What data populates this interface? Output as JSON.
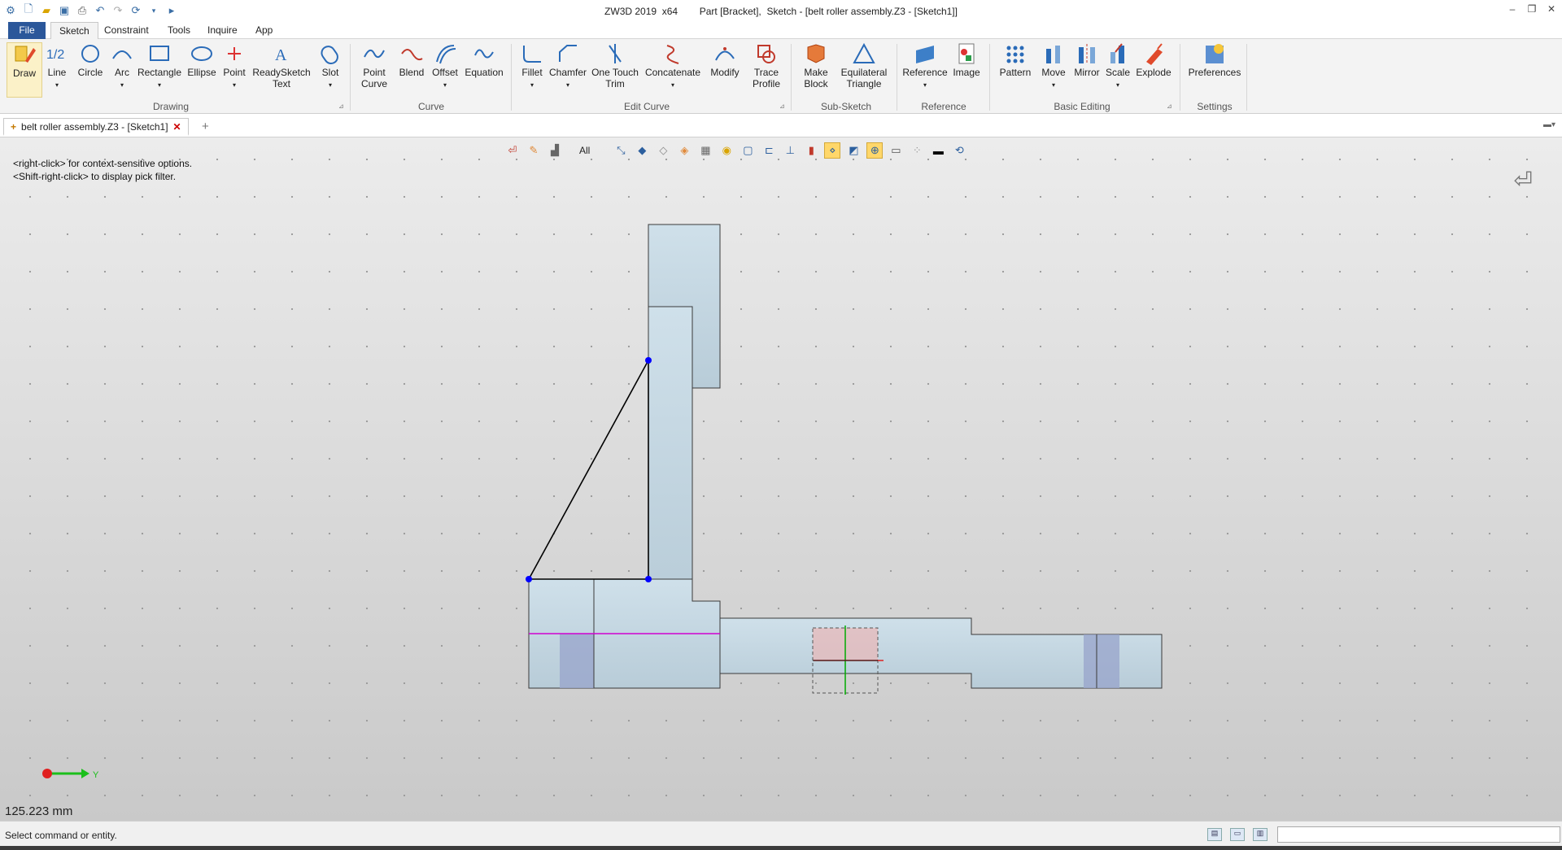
{
  "titlebar": {
    "title": "ZW3D 2019  x64        Part [Bracket],  Sketch - [belt roller assembly.Z3 - [Sketch1]]",
    "quick_access": [
      "app-logo-icon",
      "new-file-icon",
      "open-folder-icon",
      "save-icon",
      "print-icon",
      "undo-icon",
      "redo-icon",
      "rebuild-icon",
      "dropdown-arrow-icon",
      "run-icon"
    ]
  },
  "menu": {
    "tabs": [
      "File",
      "Sketch",
      "Constraint",
      "Tools",
      "Inquire",
      "App"
    ],
    "active": "Sketch"
  },
  "ribbon": {
    "drawing": {
      "label": "Drawing",
      "buttons": [
        "Draw",
        "Line",
        "Circle",
        "Arc",
        "Rectangle",
        "Ellipse",
        "Point",
        "ReadySketch\nText",
        "Slot"
      ]
    },
    "curve": {
      "label": "Curve",
      "buttons": [
        "Point\nCurve",
        "Blend",
        "Offset",
        "Equation"
      ]
    },
    "edit_curve": {
      "label": "Edit Curve",
      "buttons": [
        "Fillet",
        "Chamfer",
        "One Touch\nTrim",
        "Concatenate",
        "Modify",
        "Trace\nProfile"
      ]
    },
    "sub_sketch": {
      "label": "Sub-Sketch",
      "buttons": [
        "Make\nBlock",
        "Equilateral\nTriangle"
      ]
    },
    "reference": {
      "label": "Reference",
      "buttons": [
        "Reference",
        "Image"
      ]
    },
    "basic_editing": {
      "label": "Basic Editing",
      "buttons": [
        "Pattern",
        "Move",
        "Mirror",
        "Scale",
        "Explode"
      ]
    },
    "settings": {
      "label": "Settings",
      "buttons": [
        "Preferences"
      ]
    }
  },
  "document_tab": {
    "label": "belt roller assembly.Z3 - [Sketch1]"
  },
  "viewport": {
    "hint_line1": "<right-click> for context-sensitive options.",
    "hint_line2": "<Shift-right-click> to display pick filter.",
    "pick_filter": "All",
    "axis_label": "Y",
    "measurement": "125.223 mm"
  },
  "statusbar": {
    "text": "Select command or entity.",
    "input_value": ""
  },
  "colors": {
    "accent": "#2b579a",
    "sketch_line": "#000000",
    "sketch_point": "#0000ff",
    "highlight_edge": "#d000d0",
    "part_face": "#c5d8e2"
  }
}
